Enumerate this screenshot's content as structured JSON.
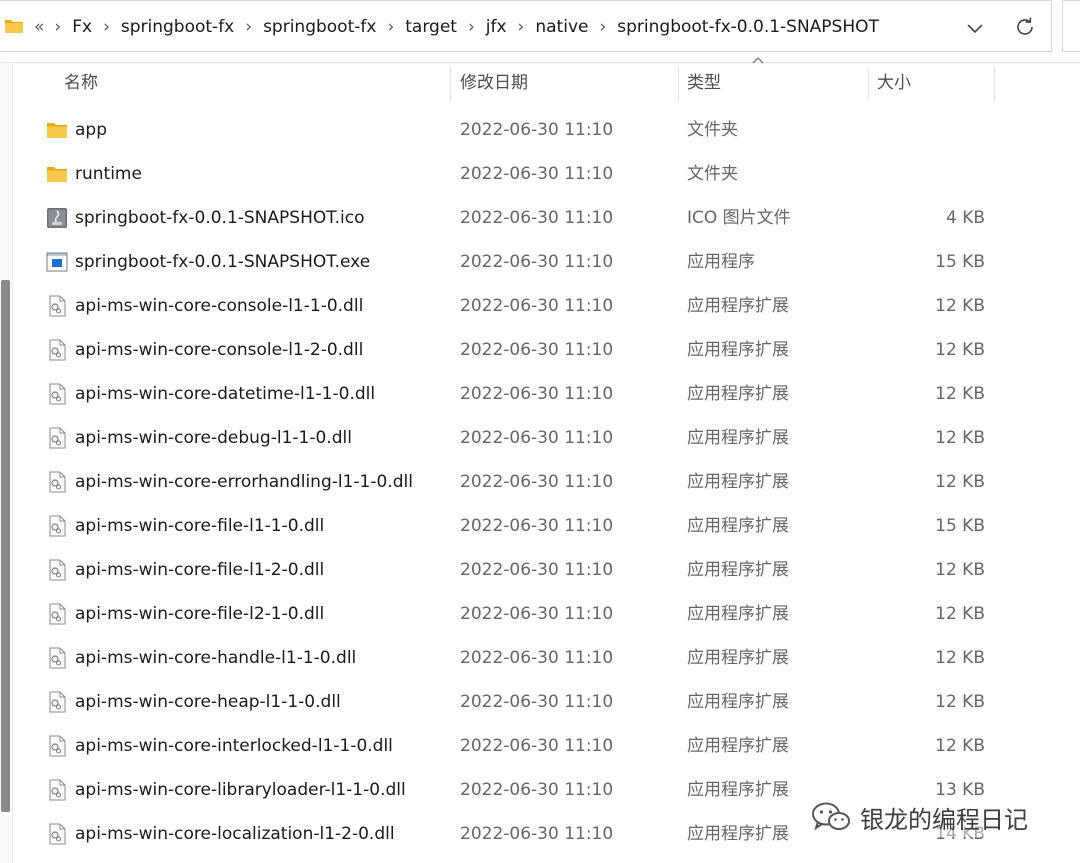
{
  "address_bar": {
    "overflow_label": "«",
    "separator": "›",
    "breadcrumbs": [
      "Fx",
      "springboot-fx",
      "springboot-fx",
      "target",
      "jfx",
      "native",
      "springboot-fx-0.0.1-SNAPSHOT"
    ],
    "dropdown_icon": "chevron-down-icon",
    "refresh_icon": "refresh-icon"
  },
  "columns": {
    "name": "名称",
    "date": "修改日期",
    "type": "类型",
    "size": "大小",
    "sorted_by": "type"
  },
  "files": [
    {
      "name": "app",
      "date": "2022-06-30 11:10",
      "type": "文件夹",
      "size": "",
      "icon": "folder"
    },
    {
      "name": "runtime",
      "date": "2022-06-30 11:10",
      "type": "文件夹",
      "size": "",
      "icon": "folder"
    },
    {
      "name": "springboot-fx-0.0.1-SNAPSHOT.ico",
      "date": "2022-06-30 11:10",
      "type": "ICO 图片文件",
      "size": "4 KB",
      "icon": "ico"
    },
    {
      "name": "springboot-fx-0.0.1-SNAPSHOT.exe",
      "date": "2022-06-30 11:10",
      "type": "应用程序",
      "size": "15 KB",
      "icon": "exe"
    },
    {
      "name": "api-ms-win-core-console-l1-1-0.dll",
      "date": "2022-06-30 11:10",
      "type": "应用程序扩展",
      "size": "12 KB",
      "icon": "dll"
    },
    {
      "name": "api-ms-win-core-console-l1-2-0.dll",
      "date": "2022-06-30 11:10",
      "type": "应用程序扩展",
      "size": "12 KB",
      "icon": "dll"
    },
    {
      "name": "api-ms-win-core-datetime-l1-1-0.dll",
      "date": "2022-06-30 11:10",
      "type": "应用程序扩展",
      "size": "12 KB",
      "icon": "dll"
    },
    {
      "name": "api-ms-win-core-debug-l1-1-0.dll",
      "date": "2022-06-30 11:10",
      "type": "应用程序扩展",
      "size": "12 KB",
      "icon": "dll"
    },
    {
      "name": "api-ms-win-core-errorhandling-l1-1-0.dll",
      "date": "2022-06-30 11:10",
      "type": "应用程序扩展",
      "size": "12 KB",
      "icon": "dll"
    },
    {
      "name": "api-ms-win-core-file-l1-1-0.dll",
      "date": "2022-06-30 11:10",
      "type": "应用程序扩展",
      "size": "15 KB",
      "icon": "dll"
    },
    {
      "name": "api-ms-win-core-file-l1-2-0.dll",
      "date": "2022-06-30 11:10",
      "type": "应用程序扩展",
      "size": "12 KB",
      "icon": "dll"
    },
    {
      "name": "api-ms-win-core-file-l2-1-0.dll",
      "date": "2022-06-30 11:10",
      "type": "应用程序扩展",
      "size": "12 KB",
      "icon": "dll"
    },
    {
      "name": "api-ms-win-core-handle-l1-1-0.dll",
      "date": "2022-06-30 11:10",
      "type": "应用程序扩展",
      "size": "12 KB",
      "icon": "dll"
    },
    {
      "name": "api-ms-win-core-heap-l1-1-0.dll",
      "date": "2022-06-30 11:10",
      "type": "应用程序扩展",
      "size": "12 KB",
      "icon": "dll"
    },
    {
      "name": "api-ms-win-core-interlocked-l1-1-0.dll",
      "date": "2022-06-30 11:10",
      "type": "应用程序扩展",
      "size": "12 KB",
      "icon": "dll"
    },
    {
      "name": "api-ms-win-core-libraryloader-l1-1-0.dll",
      "date": "2022-06-30 11:10",
      "type": "应用程序扩展",
      "size": "13 KB",
      "icon": "dll"
    },
    {
      "name": "api-ms-win-core-localization-l1-2-0.dll",
      "date": "2022-06-30 11:10",
      "type": "应用程序扩展",
      "size": "14 KB",
      "icon": "dll"
    }
  ],
  "watermark": {
    "text": "银龙的编程日记",
    "icon": "wechat-icon"
  },
  "colors": {
    "folder": "#f8c94a",
    "folder_dark": "#e6a817",
    "exe_blue": "#1f6fd1",
    "secondary_text": "#666666"
  }
}
